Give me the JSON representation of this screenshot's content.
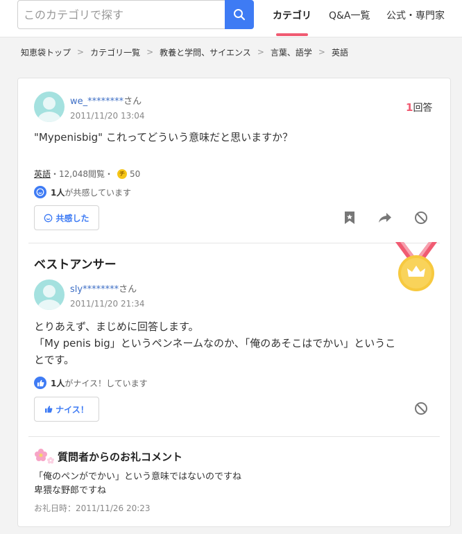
{
  "header": {
    "search_placeholder": "このカテゴリで探す",
    "nav": [
      "カテゴリ",
      "Q&A一覧",
      "公式・専門家"
    ],
    "accent": "#3e7bf4",
    "active_color": "#f05b72"
  },
  "breadcrumb": [
    "知恵袋トップ",
    "カテゴリ一覧",
    "教養と学問、サイエンス",
    "言葉、語学",
    "英語"
  ],
  "breadcrumb_sep": ">",
  "question": {
    "user": "we_********",
    "honorific": "さん",
    "date": "2011/11/20 13:04",
    "answer_count": "1",
    "answer_count_label": "回答",
    "text": "\"Mypenisbig\" これってどういう意味だと思いますか？",
    "category": "英語",
    "views": "・12,048閲覧・",
    "coin_icon": "チ",
    "coins": "50",
    "empathy_count": "1人",
    "empathy_text": "が共感しています",
    "empathy_button": "共感した"
  },
  "best_answer": {
    "title": "ベストアンサー",
    "user": "sly********",
    "honorific": "さん",
    "date": "2011/11/20 21:34",
    "lines": [
      "とりあえず、まじめに回答します。",
      "「My penis big」というペンネームなのか、「俺のあそこはでかい」というこ",
      "とです。"
    ],
    "nice_count": "1人",
    "nice_text": "がナイス！しています",
    "nice_button": "ナイス！"
  },
  "thanks": {
    "title": "質問者からのお礼コメント",
    "lines": [
      "「俺のペンがでかい」という意味ではないのですね",
      "卑猥な野郎ですね"
    ],
    "date": "お礼日時：2011/11/26 20:23"
  }
}
